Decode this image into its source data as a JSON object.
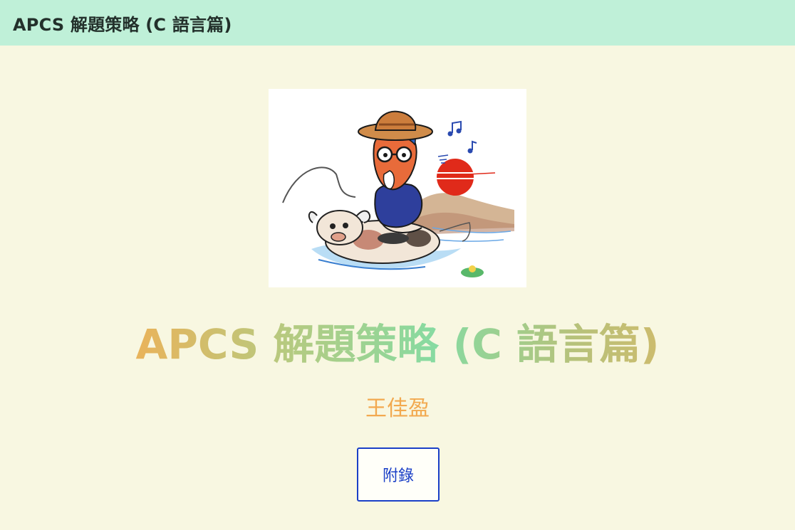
{
  "header": {
    "title": "APCS 解題策略 (C 語言篇)"
  },
  "cover": {
    "description_icon": "cartoon-cover-illustration"
  },
  "main": {
    "book_title": "APCS 解題策略 (C 語言篇)",
    "author": "王佳盈",
    "appendix_button": "附錄"
  },
  "colors": {
    "header_bg": "#bff0d8",
    "page_bg": "#f8f7e1",
    "author": "#f2a94f",
    "button_accent": "#1a3fc7"
  }
}
